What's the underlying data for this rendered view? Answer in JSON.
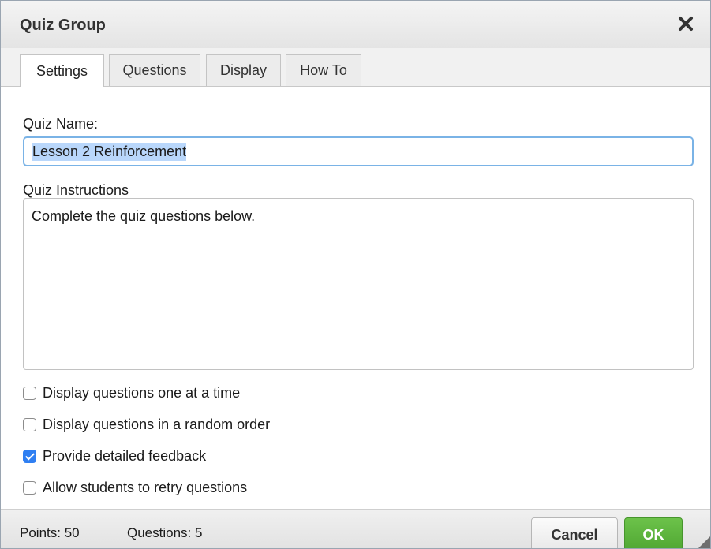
{
  "dialog": {
    "title": "Quiz Group",
    "close_icon": "close-icon"
  },
  "tabs": [
    {
      "label": "Settings",
      "active": true
    },
    {
      "label": "Questions",
      "active": false
    },
    {
      "label": "Display",
      "active": false
    },
    {
      "label": "How To",
      "active": false
    }
  ],
  "form": {
    "quiz_name_label": "Quiz Name:",
    "quiz_name_value": "Lesson 2 Reinforcement",
    "instructions_label": "Quiz Instructions",
    "instructions_value": "Complete the quiz questions below."
  },
  "options": [
    {
      "label": "Display questions one at a time",
      "checked": false
    },
    {
      "label": "Display questions in a random order",
      "checked": false
    },
    {
      "label": "Provide detailed feedback",
      "checked": true
    },
    {
      "label": "Allow students to retry questions",
      "checked": false
    }
  ],
  "footer": {
    "points": "Points: 50",
    "questions": "Questions: 5",
    "cancel_label": "Cancel",
    "ok_label": "OK"
  },
  "colors": {
    "accent_checkbox": "#2f7ff2",
    "ok_button": "#5cb43c",
    "input_focus_border": "#7ab3e6",
    "selection_highlight": "#b9d7fb"
  }
}
